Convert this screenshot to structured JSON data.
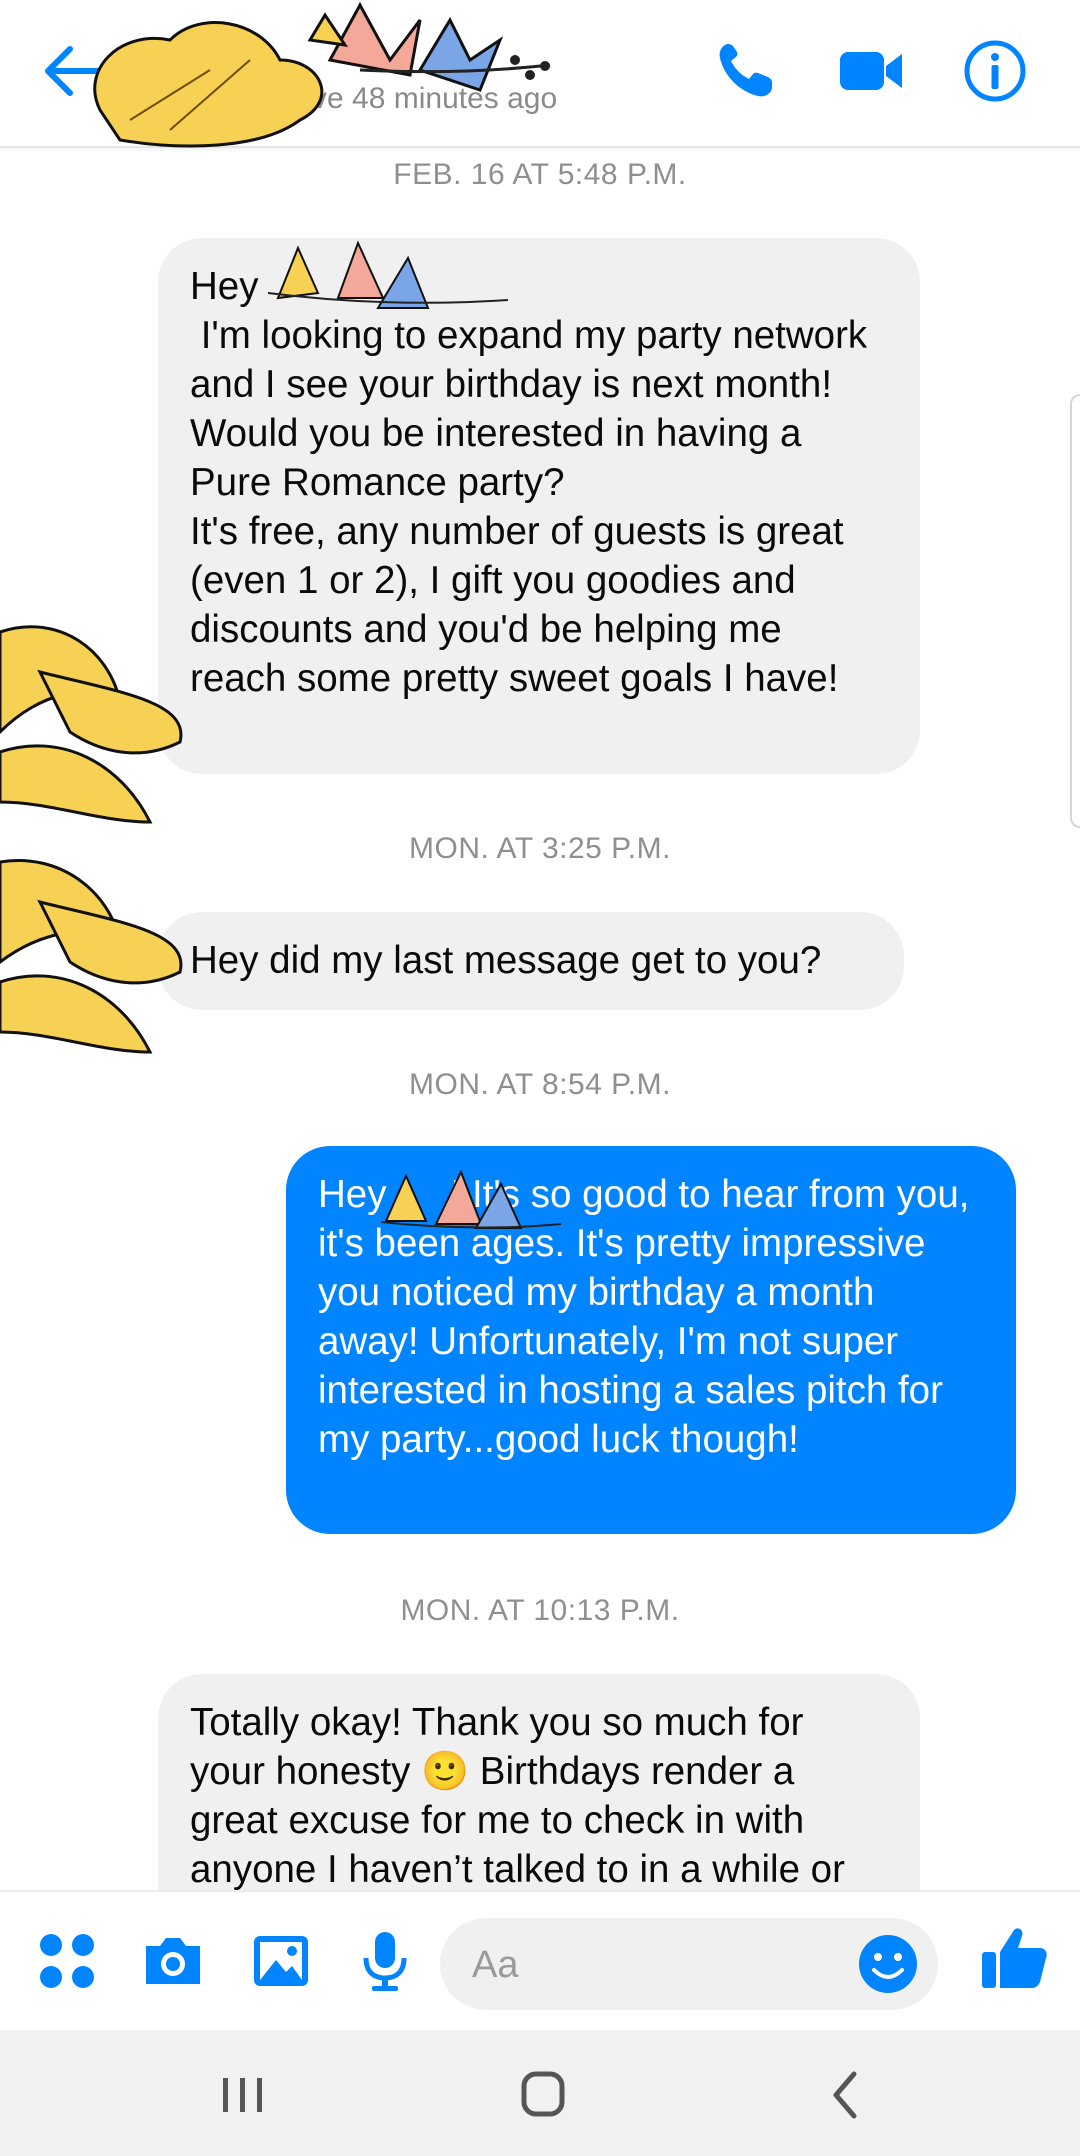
{
  "header": {
    "subtitle": "Active 48 minutes ago",
    "icons": [
      "back-arrow-icon",
      "phone-icon",
      "video-camera-icon",
      "info-icon"
    ],
    "accent": "#0084ff"
  },
  "thread": {
    "messages": [
      {
        "type": "timestamp",
        "text": "FEB. 16 AT 5:48 P.M."
      },
      {
        "type": "incoming",
        "text": "Hey \n I'm looking to expand my party network and I see your birthday is next month! Would you be interested in having a Pure Romance party?\nIt's free, any number of guests is great (even 1 or 2), I gift you goodies and discounts and you'd be helping me reach some pretty sweet goals I have!"
      },
      {
        "type": "timestamp",
        "text": "MON. AT 3:25 P.M."
      },
      {
        "type": "incoming",
        "text": "Hey did my last message get to you?"
      },
      {
        "type": "timestamp",
        "text": "MON. AT 8:54 P.M."
      },
      {
        "type": "outgoing",
        "text": "Hey      ! It's so good to hear from you, it's been ages. It's pretty impressive you noticed my birthday a month away! Unfortunately, I'm not super interested in hosting a sales pitch for my party...good luck though!"
      },
      {
        "type": "timestamp",
        "text": "MON. AT 10:13 P.M."
      },
      {
        "type": "incoming",
        "text": "Totally okay! Thank you so much for your honesty 🙂 Birthdays render a great excuse for me to check in with anyone I haven’t talked to in a while or"
      }
    ],
    "colors": {
      "incoming_bg": "#f0f0f0",
      "outgoing_bg": "#0084ff"
    }
  },
  "composer": {
    "placeholder": "Aa",
    "icons": [
      "apps-grid-icon",
      "camera-icon",
      "gallery-icon",
      "microphone-icon",
      "emoji-icon",
      "thumbs-up-icon"
    ]
  },
  "system_nav": {
    "icons": [
      "recent-apps-icon",
      "home-icon",
      "back-icon"
    ]
  }
}
